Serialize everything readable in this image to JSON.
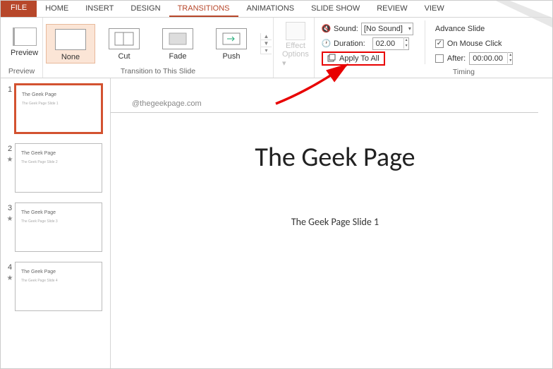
{
  "tabs": {
    "file": "FILE",
    "list": [
      "HOME",
      "INSERT",
      "DESIGN",
      "TRANSITIONS",
      "ANIMATIONS",
      "SLIDE SHOW",
      "REVIEW",
      "VIEW"
    ],
    "active_index": 3
  },
  "ribbon": {
    "preview": {
      "label": "Preview",
      "group_label": "Preview"
    },
    "transitions": {
      "group_label": "Transition to This Slide",
      "items": [
        {
          "name": "None",
          "selected": true
        },
        {
          "name": "Cut",
          "selected": false
        },
        {
          "name": "Fade",
          "selected": false
        },
        {
          "name": "Push",
          "selected": false
        }
      ]
    },
    "effect_options": {
      "label": "Effect",
      "label2": "Options"
    },
    "timing": {
      "group_label": "Timing",
      "sound_label": "Sound:",
      "sound_value": "[No Sound]",
      "duration_label": "Duration:",
      "duration_value": "02.00",
      "apply_all": "Apply To All"
    },
    "advance": {
      "title": "Advance Slide",
      "mouse_label": "On Mouse Click",
      "mouse_checked": true,
      "after_label": "After:",
      "after_checked": false,
      "after_value": "00:00.00"
    }
  },
  "thumbnails": [
    {
      "num": "1",
      "title": "The Geek Page",
      "sub": "The Geek Page Slide 1",
      "active": true,
      "star": false
    },
    {
      "num": "2",
      "title": "The Geek Page",
      "sub": "The Geek Page Slide 2",
      "active": false,
      "star": true
    },
    {
      "num": "3",
      "title": "The Geek Page",
      "sub": "The Geek Page Slide 3",
      "active": false,
      "star": true
    },
    {
      "num": "4",
      "title": "The Geek Page",
      "sub": "The Geek Page Slide 4",
      "active": false,
      "star": true
    }
  ],
  "slide": {
    "watermark": "@thegeekpage.com",
    "title": "The Geek Page",
    "subtitle": "The Geek Page Slide 1"
  },
  "colors": {
    "accent": "#b7472a",
    "highlight": "#e80000"
  }
}
